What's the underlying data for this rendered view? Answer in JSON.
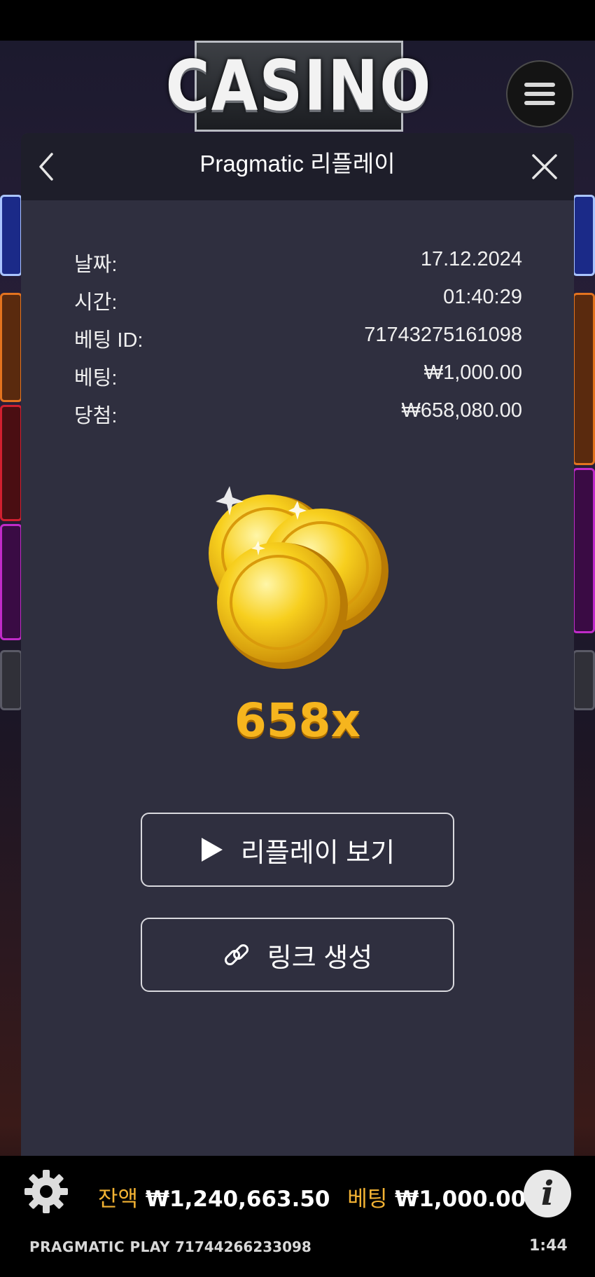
{
  "game": {
    "logo_text": "CASINO"
  },
  "dialog": {
    "title": "Pragmatic 리플레이",
    "rows": [
      {
        "label": "날짜:",
        "value": "17.12.2024"
      },
      {
        "label": "시간:",
        "value": "01:40:29"
      },
      {
        "label": "베팅 ID:",
        "value": "71743275161098"
      },
      {
        "label": "베팅:",
        "value": "₩1,000.00"
      },
      {
        "label": "당첨:",
        "value": "₩658,080.00"
      }
    ],
    "multiplier": "658x",
    "replay_button": "리플레이 보기",
    "link_button": "링크 생성"
  },
  "bottom": {
    "balance_label": "잔액",
    "balance_value": "₩1,240,663.50",
    "bet_label": "베팅",
    "bet_value": "₩1,000.00",
    "brand": "PRAGMATIC PLAY",
    "round_id": "71744266233098",
    "time": "1:44"
  },
  "icons": {
    "back": "chevron-left-icon",
    "close": "close-icon",
    "menu": "hamburger-menu-icon",
    "play": "play-icon",
    "link": "link-icon",
    "settings": "gear-icon",
    "info": "info-icon"
  },
  "colors": {
    "dialog_bg": "#2f2f3f",
    "header_bg": "#1e1e2a",
    "multiplier": "#f6b51e",
    "bottom_labels": "#f2b233"
  }
}
